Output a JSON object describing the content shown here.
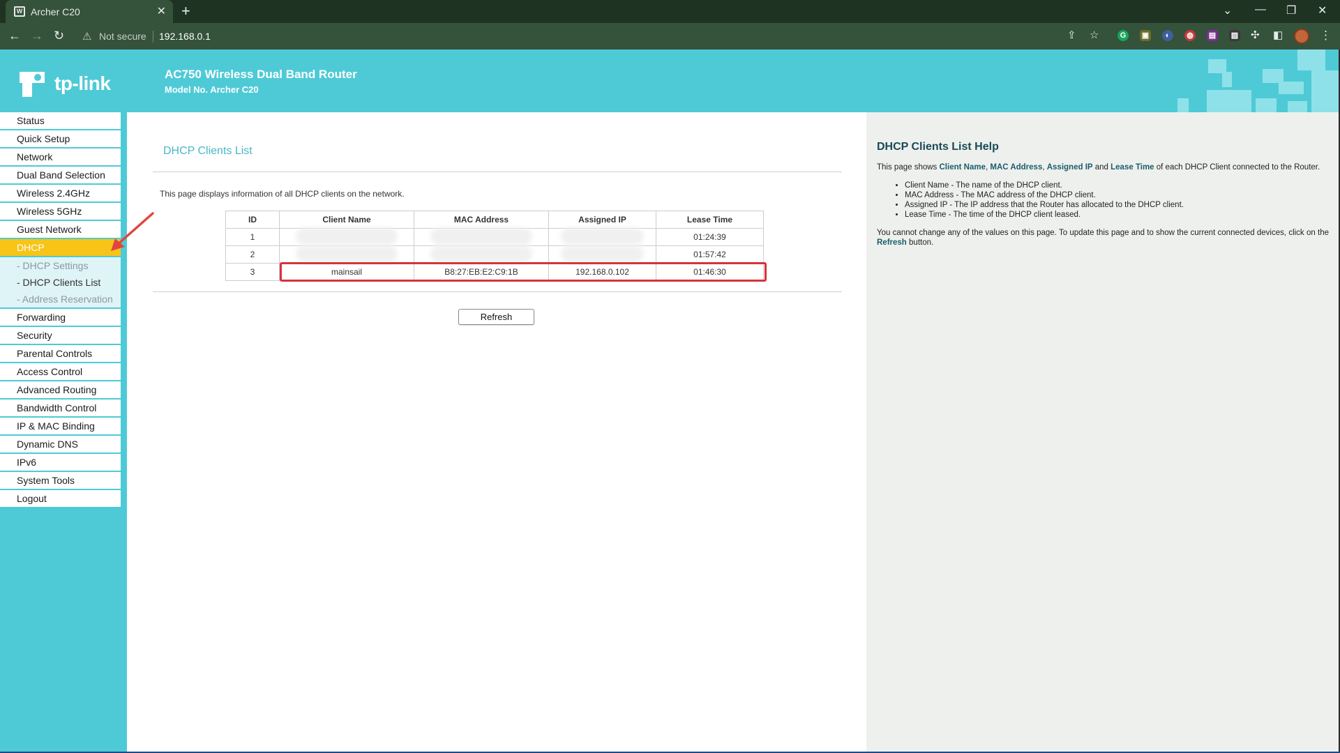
{
  "browser": {
    "tab_title": "Archer C20",
    "favicon_text": "W",
    "security_label": "Not secure",
    "url": "192.168.0.1"
  },
  "header": {
    "logo_text": "tp-link",
    "product_title": "AC750 Wireless Dual Band Router",
    "model_no": "Model No. Archer C20"
  },
  "menu": {
    "items_top": [
      "Status",
      "Quick Setup",
      "Network",
      "Dual Band Selection",
      "Wireless 2.4GHz",
      "Wireless 5GHz",
      "Guest Network"
    ],
    "active": "DHCP",
    "submenu": [
      "- DHCP Settings",
      "- DHCP Clients List",
      "- Address Reservation"
    ],
    "items_bottom": [
      "Forwarding",
      "Security",
      "Parental Controls",
      "Access Control",
      "Advanced Routing",
      "Bandwidth Control",
      "IP & MAC Binding",
      "Dynamic DNS",
      "IPv6",
      "System Tools",
      "Logout"
    ]
  },
  "main": {
    "title": "DHCP Clients List",
    "intro": "This page displays information of all DHCP clients on the network.",
    "table": {
      "headers": [
        "ID",
        "Client Name",
        "MAC Address",
        "Assigned IP",
        "Lease Time"
      ],
      "rows": [
        [
          "1",
          "",
          "",
          "",
          "01:24:39"
        ],
        [
          "2",
          "",
          "",
          "",
          "01:57:42"
        ],
        [
          "3",
          "mainsail",
          "B8:27:EB:E2:C9:1B",
          "192.168.0.102",
          "01:46:30"
        ]
      ]
    },
    "refresh_label": "Refresh"
  },
  "help": {
    "title": "DHCP Clients List Help",
    "intro_pre": "This page shows ",
    "intro_t1": "Client Name",
    "intro_c1": ", ",
    "intro_t2": "MAC Address",
    "intro_c2": ", ",
    "intro_t3": "Assigned IP",
    "intro_c3": " and ",
    "intro_t4": "Lease Time",
    "intro_post": " of each DHCP Client connected to the Router.",
    "bullets": [
      "Client Name - The name of the DHCP client.",
      "MAC Address - The MAC address of the DHCP client.",
      "Assigned IP - The IP address that the Router has allocated to the DHCP client.",
      "Lease Time - The time of the DHCP client leased."
    ],
    "note_pre": "You cannot change any of the values on this page. To update this page and to show the current connected devices, click on the ",
    "note_link": "Refresh",
    "note_post": " button."
  },
  "colors": {
    "brand_teal": "#4ecad6",
    "menu_active": "#f7c417",
    "highlight_red": "#d6333c"
  }
}
